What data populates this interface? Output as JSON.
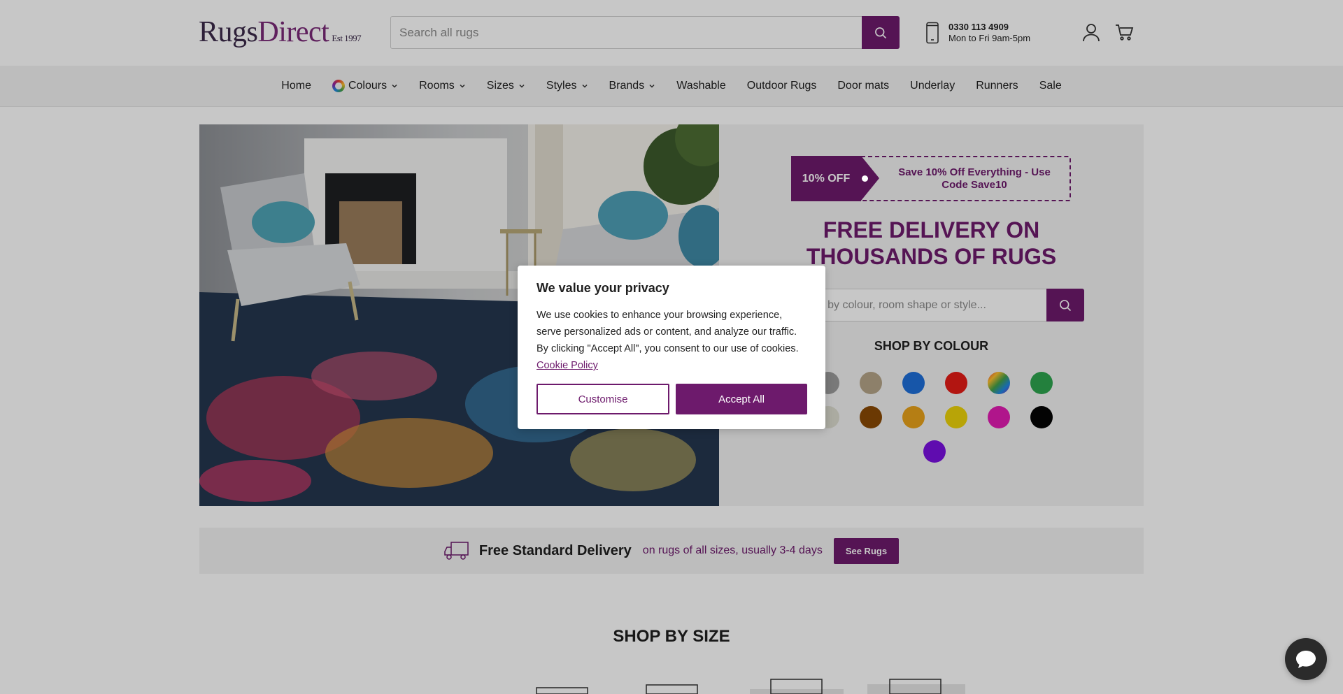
{
  "header": {
    "logo": {
      "rugs": "Rugs",
      "direct": "Direct",
      "est": "Est 1997"
    },
    "search": {
      "placeholder": "Search all rugs"
    },
    "phone": {
      "number": "0330 113 4909",
      "hours": "Mon to Fri 9am-5pm"
    }
  },
  "nav": {
    "items": [
      {
        "label": "Home",
        "dropdown": false
      },
      {
        "label": "Colours",
        "dropdown": true
      },
      {
        "label": "Rooms",
        "dropdown": true
      },
      {
        "label": "Sizes",
        "dropdown": true
      },
      {
        "label": "Styles",
        "dropdown": true
      },
      {
        "label": "Brands",
        "dropdown": true
      },
      {
        "label": "Washable",
        "dropdown": false
      },
      {
        "label": "Outdoor Rugs",
        "dropdown": false
      },
      {
        "label": "Door mats",
        "dropdown": false
      },
      {
        "label": "Underlay",
        "dropdown": false
      },
      {
        "label": "Runners",
        "dropdown": false
      },
      {
        "label": "Sale",
        "dropdown": false
      }
    ]
  },
  "hero": {
    "promo_badge": "10% OFF",
    "promo_text": "Save 10% Off Everything - Use Code Save10",
    "heading_line1": "FREE DELIVERY ON",
    "heading_line2": "THOUSANDS OF RUGS",
    "search_placeholder": "Search by colour, room shape or style...",
    "shop_by_colour": "SHOP BY COLOUR",
    "colours": [
      "#9b9b9b",
      "#b5a588",
      "#1e6fd9",
      "#e41b17",
      "multicolour",
      "#2ea44f",
      "#dcdccf",
      "#8a4a05",
      "#e8a21a",
      "#ecd20a",
      "#e21bb3",
      "#050505",
      "#7a10e0"
    ]
  },
  "delivery": {
    "title": "Free Standard Delivery",
    "subtitle": "on rugs of all sizes, usually 3-4 days",
    "cta": "See Rugs"
  },
  "shop_by_size": "SHOP BY SIZE",
  "cookie": {
    "title": "We value your privacy",
    "body": "We use cookies to enhance your browsing experience, serve personalized ads or content, and analyze our traffic. By clicking \"Accept All\", you consent to our use of cookies.",
    "link": "Cookie Policy",
    "customise": "Customise",
    "accept": "Accept All"
  },
  "colors": {
    "brand": "#6d1a6c",
    "overlay": "rgba(0,0,0,0.22)"
  }
}
